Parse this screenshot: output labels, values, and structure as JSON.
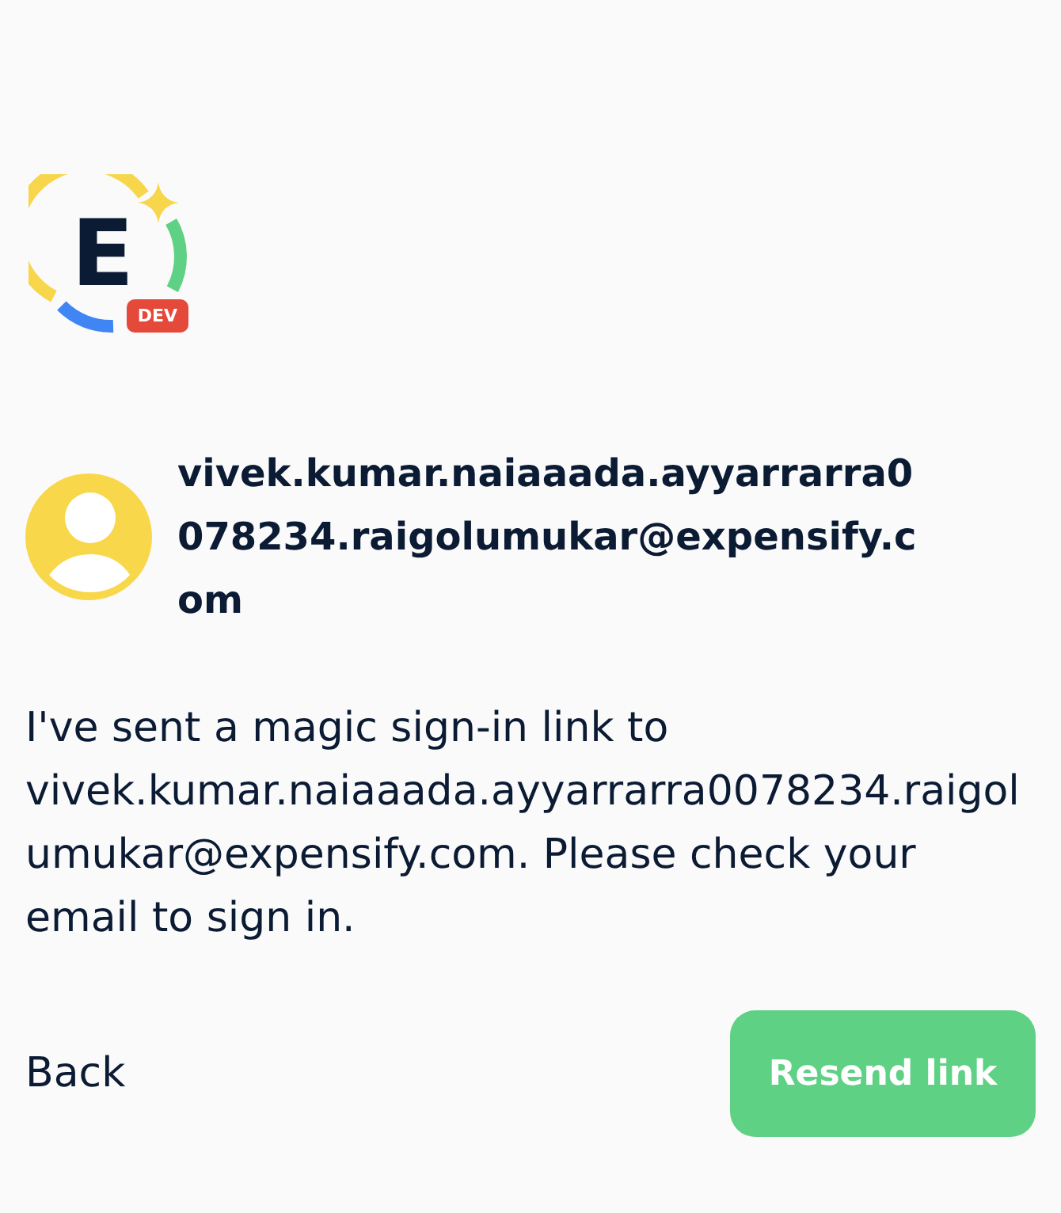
{
  "logo": {
    "letter": "E",
    "badge": "DEV"
  },
  "account": {
    "email": "vivek.kumar.naiaaada.ayyarrarra0078234.raigolumukar@expensify.com"
  },
  "message": "I've sent a magic sign-in link to vivek.kumar.naiaaada.ayyarrarra0078234.raigolumukar@expensify.com. Please check your email to sign in.",
  "actions": [
    {
      "label": "Back",
      "kind": "link"
    },
    {
      "label": "Resend link",
      "kind": "primary"
    }
  ]
}
